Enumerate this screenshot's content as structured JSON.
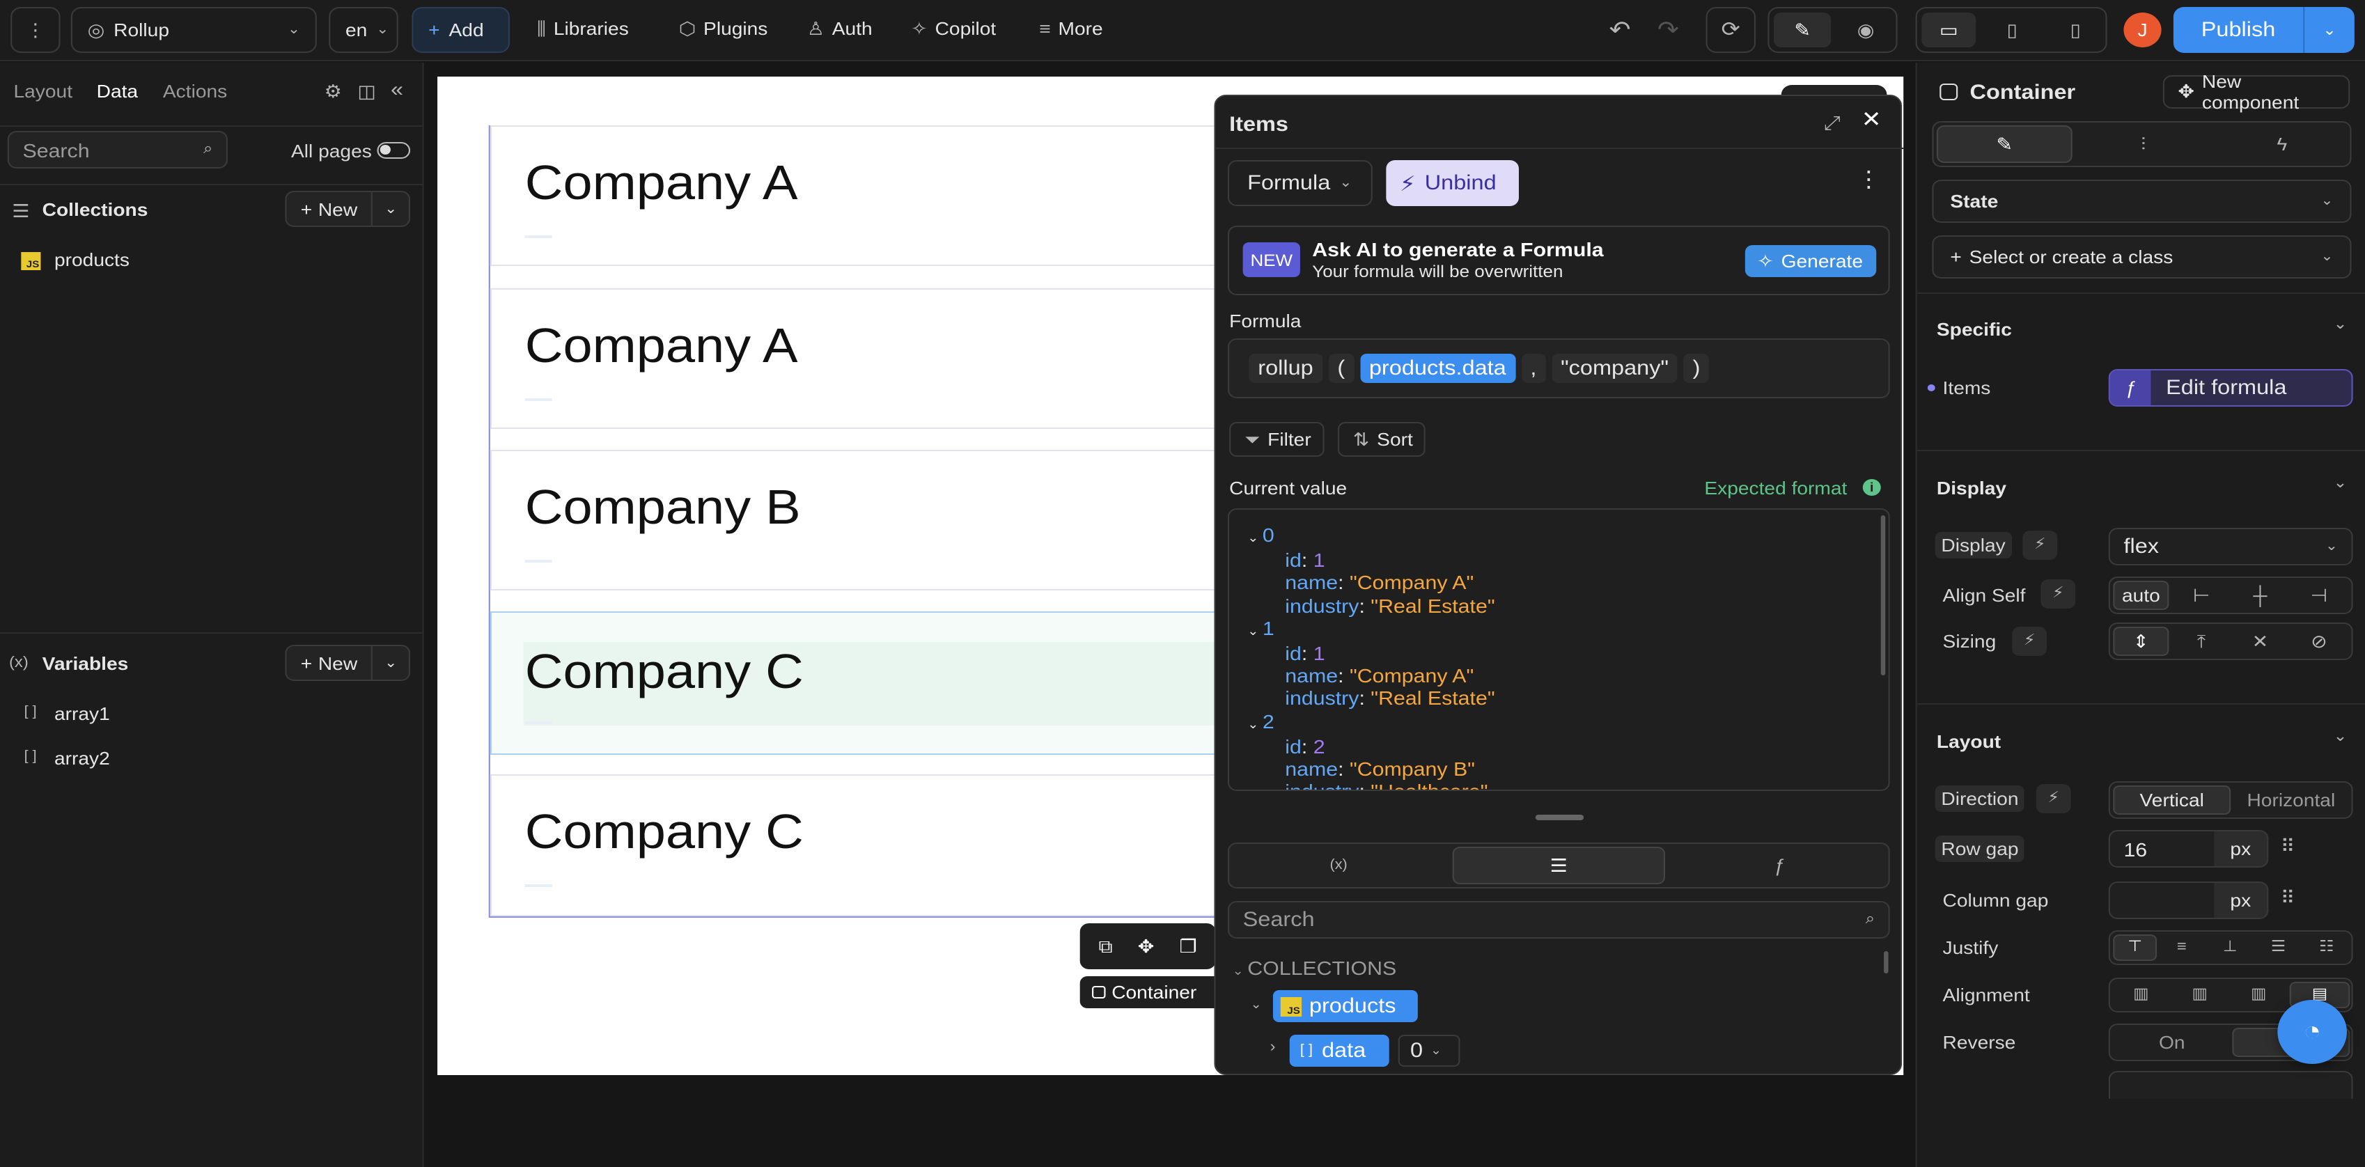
{
  "topbar": {
    "project": "Rollup",
    "lang": "en",
    "add": "Add",
    "libraries": "Libraries",
    "plugins": "Plugins",
    "auth": "Auth",
    "copilot": "Copilot",
    "more": "More",
    "avatar": "J",
    "publish": "Publish"
  },
  "left": {
    "tabs": [
      "Layout",
      "Data",
      "Actions"
    ],
    "search_placeholder": "Search",
    "all_pages": "All pages",
    "collections_title": "Collections",
    "new_label": "New",
    "collection_item": "products",
    "collection_badge": "JS",
    "variables_title": "Variables",
    "variables": [
      "array1",
      "array2"
    ]
  },
  "canvas": {
    "cards": [
      "Company A",
      "Company A",
      "Company B",
      "Company C",
      "Company C"
    ],
    "container_tag": "Container"
  },
  "items_panel": {
    "title": "Items",
    "formula_btn": "Formula",
    "unbind_btn": "Unbind",
    "ai_badge": "NEW",
    "ai_title": "Ask AI to generate a Formula",
    "ai_sub": "Your formula will be overwritten",
    "generate_btn": "Generate",
    "formula_label": "Formula",
    "formula_fn": "rollup",
    "formula_open": "(",
    "formula_arg1": "products.data",
    "formula_comma": ",",
    "formula_arg2": "\"company\"",
    "formula_close": ")",
    "filter_btn": "Filter",
    "sort_btn": "Sort",
    "current_value_label": "Current value",
    "expected_format": "Expected format",
    "tree": [
      {
        "index": "0",
        "id": "1",
        "name": "\"Company A\"",
        "industry": "\"Real Estate\""
      },
      {
        "index": "1",
        "id": "1",
        "name": "\"Company A\"",
        "industry": "\"Real Estate\""
      },
      {
        "index": "2",
        "id": "2",
        "name": "\"Company B\"",
        "industry": "\"Healthcare\""
      }
    ],
    "key_id": "id",
    "key_name": "name",
    "key_industry": "industry",
    "search_placeholder": "Search",
    "collections_heading": "COLLECTIONS",
    "coll_item": "products",
    "coll_badge": "JS",
    "data_item": "data",
    "data_index": "0"
  },
  "right": {
    "container_title": "Container",
    "new_component": "New component",
    "state": "State",
    "class_select": "Select or create a class",
    "specific": "Specific",
    "items_label": "Items",
    "edit_formula": "Edit formula",
    "display_section": "Display",
    "display_label": "Display",
    "display_value": "flex",
    "align_self_label": "Align Self",
    "align_self_value": "auto",
    "sizing_label": "Sizing",
    "layout_section": "Layout",
    "direction_label": "Direction",
    "dir_vertical": "Vertical",
    "dir_horizontal": "Horizontal",
    "row_gap_label": "Row gap",
    "row_gap_value": "16",
    "px": "px",
    "column_gap_label": "Column gap",
    "justify_label": "Justify",
    "alignment_label": "Alignment",
    "reverse_label": "Reverse",
    "reverse_on": "On"
  },
  "colors": {
    "accent": "#2f8cf0",
    "publish": "#3b8ef0",
    "ai_badge": "#5b5bd6",
    "expected": "#5fc48a",
    "avatar": "#e8572d"
  }
}
